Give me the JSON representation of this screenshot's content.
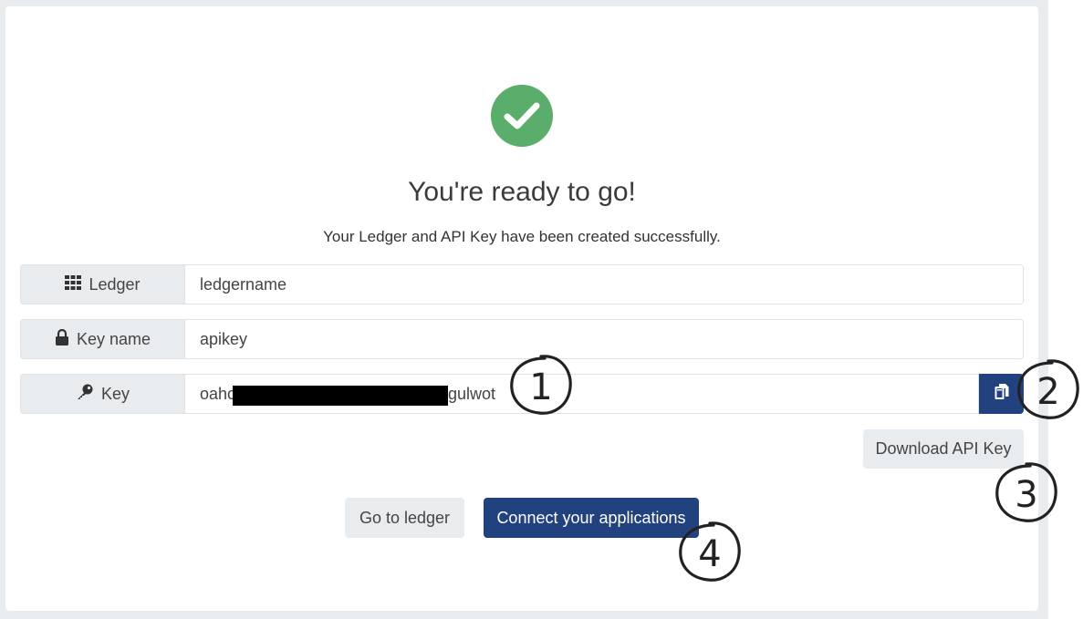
{
  "header": {
    "title": "You're ready to go!",
    "subtitle": "Your Ledger and API Key have been created successfully."
  },
  "fields": {
    "ledger": {
      "label": "Ledger",
      "value": "ledgername",
      "icon": "grid-icon"
    },
    "key_name": {
      "label": "Key name",
      "value": "apikey",
      "icon": "lock-icon"
    },
    "key": {
      "label": "Key",
      "value_prefix": "oahc",
      "value_suffix": "gulwot",
      "icon": "key-icon",
      "redacted": true
    }
  },
  "actions": {
    "copy_icon": "copy-icon",
    "download_label": "Download API Key",
    "go_to_ledger_label": "Go to ledger",
    "connect_label": "Connect your applications"
  },
  "annotations": [
    "1",
    "2",
    "3",
    "4"
  ],
  "colors": {
    "primary": "#22427f",
    "success": "#5aad6a",
    "addon_bg": "#e9ecef"
  }
}
